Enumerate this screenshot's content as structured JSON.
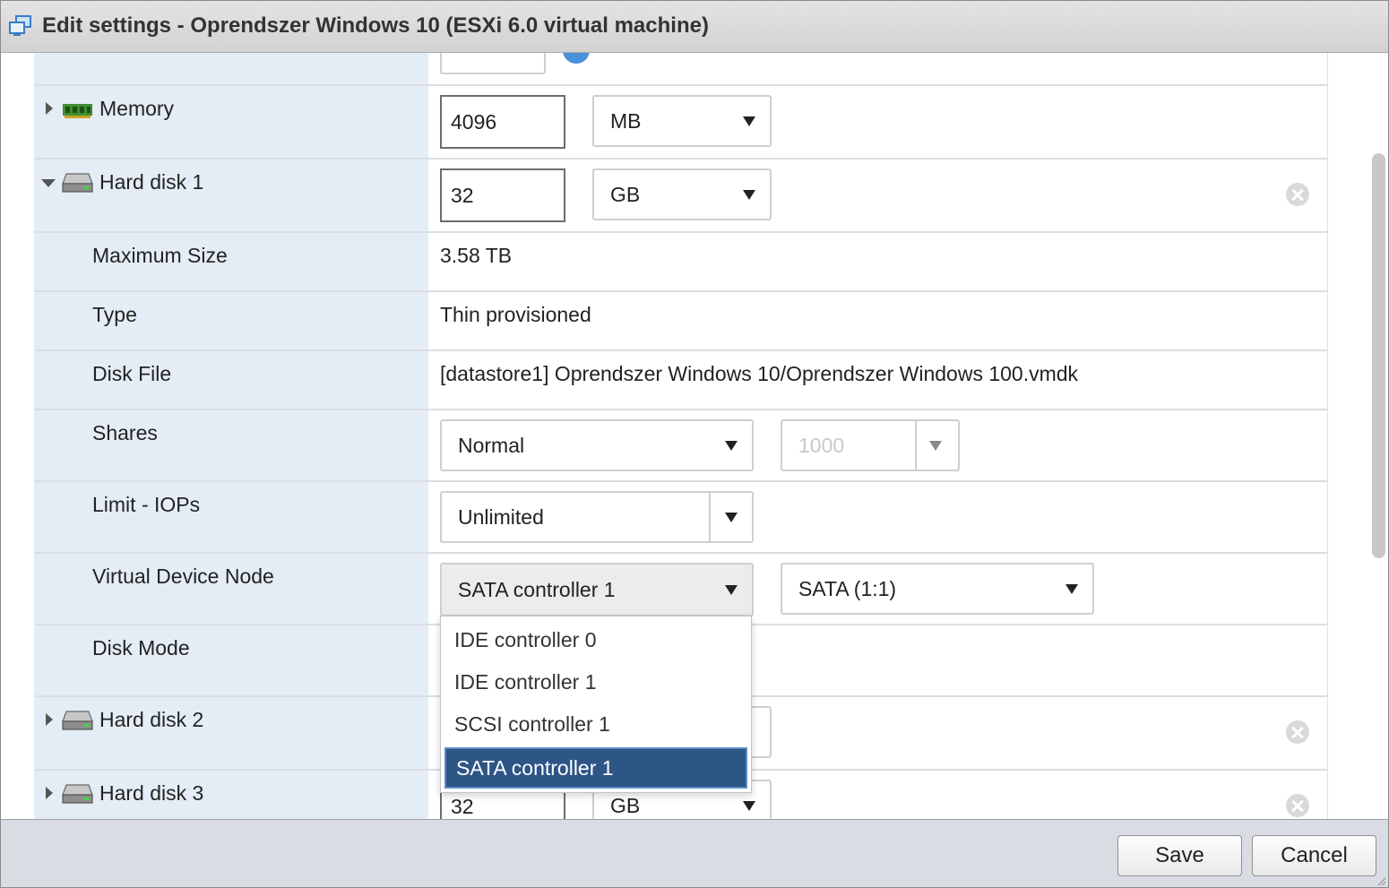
{
  "window": {
    "title": "Edit settings - Oprendszer Windows 10 (ESXi 6.0 virtual machine)"
  },
  "memory": {
    "label": "Memory",
    "value": "4096",
    "unit": "MB"
  },
  "hard_disk_1": {
    "label": "Hard disk 1",
    "size": "32",
    "unit": "GB",
    "maximum_size": {
      "label": "Maximum Size",
      "value": "3.58 TB"
    },
    "type": {
      "label": "Type",
      "value": "Thin provisioned"
    },
    "disk_file": {
      "label": "Disk File",
      "value": "[datastore1] Oprendszer Windows 10/Oprendszer Windows 100.vmdk"
    },
    "shares": {
      "label": "Shares",
      "level": "Normal",
      "value": "1000"
    },
    "limit_iops": {
      "label": "Limit - IOPs",
      "value": "Unlimited"
    },
    "virtual_device_node": {
      "label": "Virtual Device Node",
      "controller": "SATA controller 1",
      "node": "SATA (1:1)"
    },
    "disk_mode": {
      "label": "Disk Mode"
    }
  },
  "controller_dropdown": {
    "options": [
      "IDE controller 0",
      "IDE controller 1",
      "SCSI controller 1",
      "SATA controller 1"
    ],
    "selected": "SATA controller 1"
  },
  "hard_disk_2": {
    "label": "Hard disk 2"
  },
  "hard_disk_3": {
    "label": "Hard disk 3",
    "size": "32",
    "unit": "GB"
  },
  "buttons": {
    "save": "Save",
    "cancel": "Cancel"
  },
  "colors": {
    "label_panel": "#e4edf5",
    "selected_option": "#2d5586",
    "footer": "#d9dce3"
  }
}
